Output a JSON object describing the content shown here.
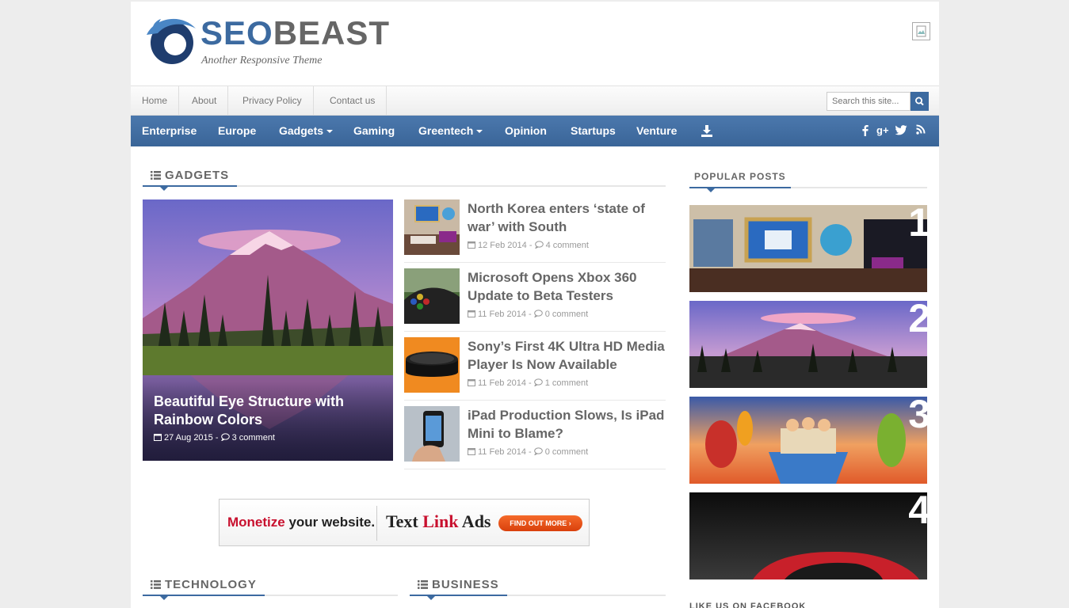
{
  "site": {
    "name_part1": "SEO",
    "name_part2": "BEAST",
    "tagline": "Another Responsive Theme"
  },
  "topnav": {
    "items": [
      "Home",
      "About",
      "Privacy Policy",
      "Contact us"
    ],
    "search_placeholder": "Search this site..."
  },
  "mainnav": {
    "items": [
      "Enterprise",
      "Europe",
      "Gadgets",
      "Gaming",
      "Greentech",
      "Opinion",
      "Startups",
      "Venture"
    ],
    "social": [
      "facebook-icon",
      "google-plus-icon",
      "twitter-icon",
      "rss-icon"
    ]
  },
  "gadgets": {
    "heading": "GADGETS",
    "featured": {
      "title": "Beautiful Eye Structure with Rainbow Colors",
      "date": "27 Aug 2015",
      "comments": "3 comment"
    },
    "articles": [
      {
        "title": "North Korea enters ‘state of war’ with South",
        "date": "12 Feb 2014",
        "comments": "4 comment"
      },
      {
        "title": "Microsoft Opens Xbox 360 Update to Beta Testers",
        "date": "11 Feb 2014",
        "comments": "0 comment"
      },
      {
        "title": "Sony’s First 4K Ultra HD Media Player Is Now Available",
        "date": "11 Feb 2014",
        "comments": "1 comment"
      },
      {
        "title": "iPad Production Slows, Is iPad Mini to Blame?",
        "date": "11 Feb 2014",
        "comments": "0 comment"
      }
    ]
  },
  "ad": {
    "part1_red": "Monetize",
    "part1_rest": " your website.",
    "part2_a": "Text ",
    "part2_red": "Link",
    "part2_b": " Ads",
    "button": "FIND OUT MORE"
  },
  "sections": {
    "technology": "TECHNOLOGY",
    "business": "BUSINESS"
  },
  "popular": {
    "heading": "POPULAR POSTS",
    "ranks": [
      "1",
      "2",
      "3",
      "4"
    ],
    "next_heading": "LIKE US ON FACEBOOK"
  }
}
